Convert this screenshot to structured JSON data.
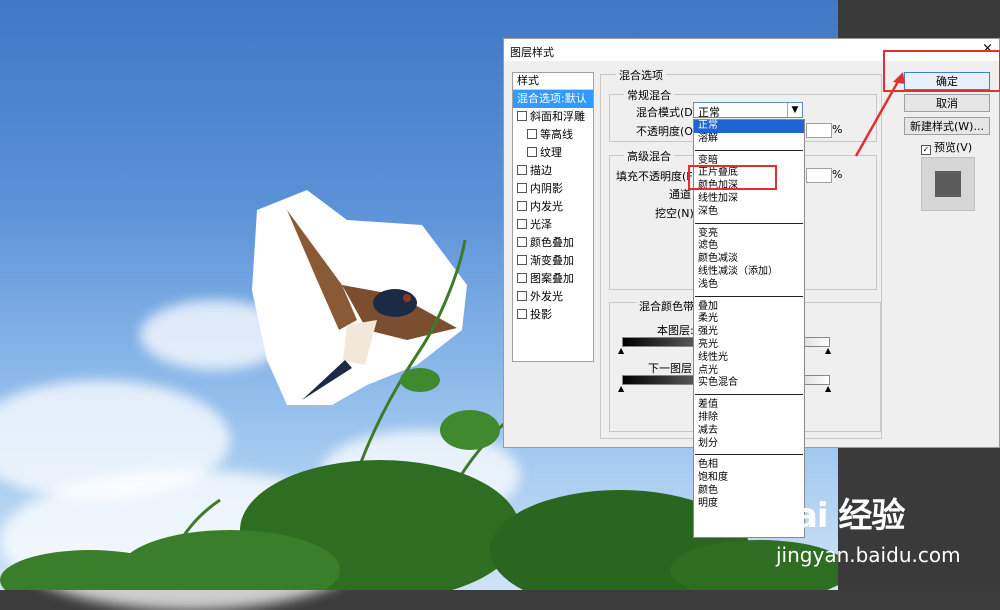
{
  "dialog": {
    "title": "图层样式",
    "close": "×",
    "styles_header": "样式",
    "styles": [
      {
        "label": "混合选项:默认",
        "checkbox": false,
        "selected": true,
        "indent": false
      },
      {
        "label": "斜面和浮雕",
        "checkbox": true,
        "indent": false
      },
      {
        "label": "等高线",
        "checkbox": true,
        "indent": true
      },
      {
        "label": "纹理",
        "checkbox": true,
        "indent": true
      },
      {
        "label": "描边",
        "checkbox": true,
        "indent": false
      },
      {
        "label": "内阴影",
        "checkbox": true,
        "indent": false
      },
      {
        "label": "内发光",
        "checkbox": true,
        "indent": false
      },
      {
        "label": "光泽",
        "checkbox": true,
        "indent": false
      },
      {
        "label": "颜色叠加",
        "checkbox": true,
        "indent": false
      },
      {
        "label": "渐变叠加",
        "checkbox": true,
        "indent": false
      },
      {
        "label": "图案叠加",
        "checkbox": true,
        "indent": false
      },
      {
        "label": "外发光",
        "checkbox": true,
        "indent": false
      },
      {
        "label": "投影",
        "checkbox": true,
        "indent": false
      }
    ],
    "blend_options": {
      "group_title": "混合选项",
      "general_title": "常规混合",
      "blend_mode_label": "混合模式(D):",
      "blend_mode_value": "正常",
      "opacity_label": "不透明度(O):",
      "percent": "%",
      "advanced_title": "高级混合",
      "fill_opacity_label": "填充不透明度(F",
      "channels_label": "通道",
      "knockout_label": "挖空(N):",
      "blend_if_title": "混合颜色带(E",
      "this_layer_label": "本图层:",
      "underlying_label": "下一图层:"
    },
    "buttons": {
      "ok": "确定",
      "cancel": "取消",
      "new_style": "新建样式(W)...",
      "preview": "预览(V)"
    }
  },
  "dropdown": {
    "groups": [
      [
        "正常",
        "溶解"
      ],
      [
        "变暗",
        "正片叠底",
        "颜色加深",
        "线性加深",
        "深色"
      ],
      [
        "变亮",
        "滤色",
        "颜色减淡",
        "线性减淡（添加）",
        "浅色"
      ],
      [
        "叠加",
        "柔光",
        "强光",
        "亮光",
        "线性光",
        "点光",
        "实色混合"
      ],
      [
        "差值",
        "排除",
        "减去",
        "划分"
      ],
      [
        "色相",
        "饱和度",
        "颜色",
        "明度"
      ]
    ],
    "selected": "正常"
  },
  "watermark": {
    "logo": "Bai 经验",
    "url": "jingyan.baidu.com"
  },
  "colors": {
    "annotation": "#e03030",
    "selection": "#1e64d2",
    "sky": "#5b92d8"
  }
}
